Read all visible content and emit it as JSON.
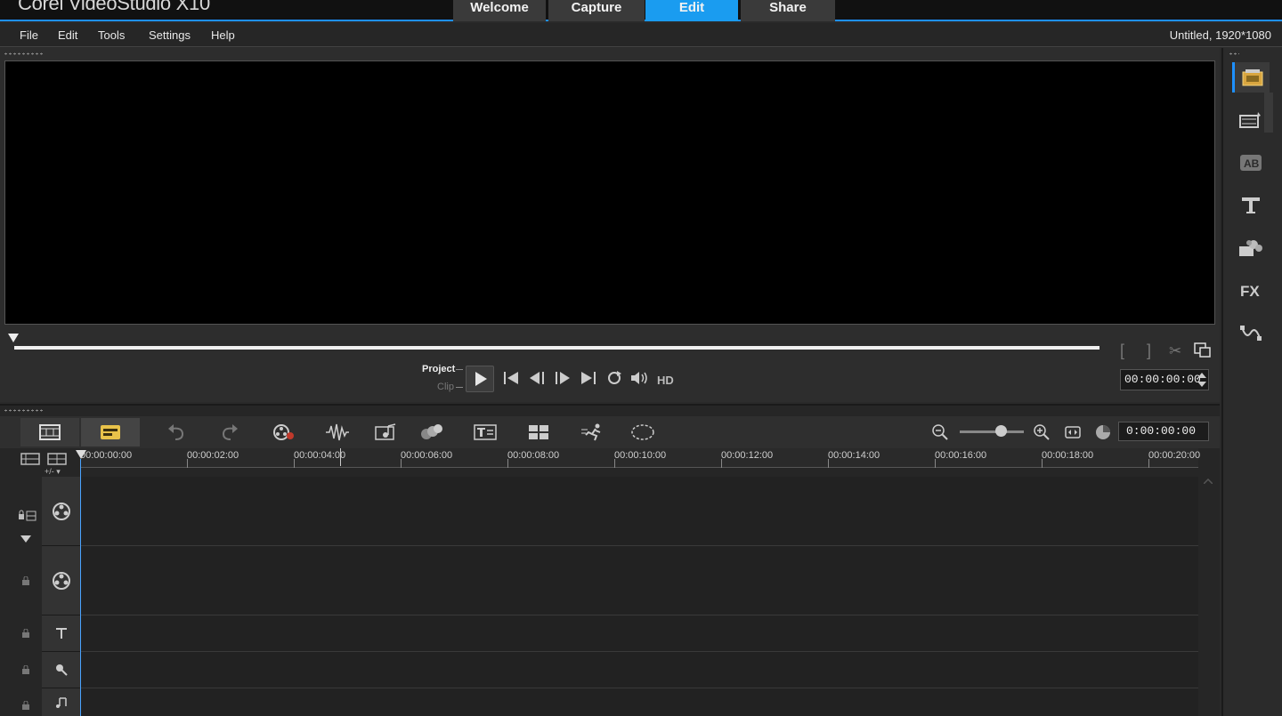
{
  "app": {
    "title": "Corel VideoStudio X10",
    "project_info": "Untitled, 1920*1080"
  },
  "mode_tabs": [
    {
      "label": "Welcome",
      "active": false
    },
    {
      "label": "Capture",
      "active": false
    },
    {
      "label": "Edit",
      "active": true
    },
    {
      "label": "Share",
      "active": false
    }
  ],
  "menu": {
    "file": "File",
    "edit": "Edit",
    "tools": "Tools",
    "settings": "Settings",
    "help": "Help"
  },
  "player": {
    "mode_project": "Project",
    "mode_clip": "Clip",
    "hd": "HD",
    "timecode": "00:00:00:00"
  },
  "timeline": {
    "timecode": "0:00:00:00",
    "ruler_labels": [
      "00:00:00:00",
      "00:00:02:00",
      "00:00:04:00",
      "00:00:06:00",
      "00:00:08:00",
      "00:00:10:00",
      "00:00:12:00",
      "00:00:14:00",
      "00:00:16:00",
      "00:00:18:00",
      "00:00:20:00"
    ],
    "track_controls_label": "+/- ▾"
  },
  "colors": {
    "accent": "#1a9cf0",
    "background": "#2a2a2a"
  },
  "library_icons": [
    "media-icon",
    "instant-project-icon",
    "transition-icon",
    "title-icon",
    "graphic-icon",
    "filter-icon",
    "path-icon"
  ]
}
